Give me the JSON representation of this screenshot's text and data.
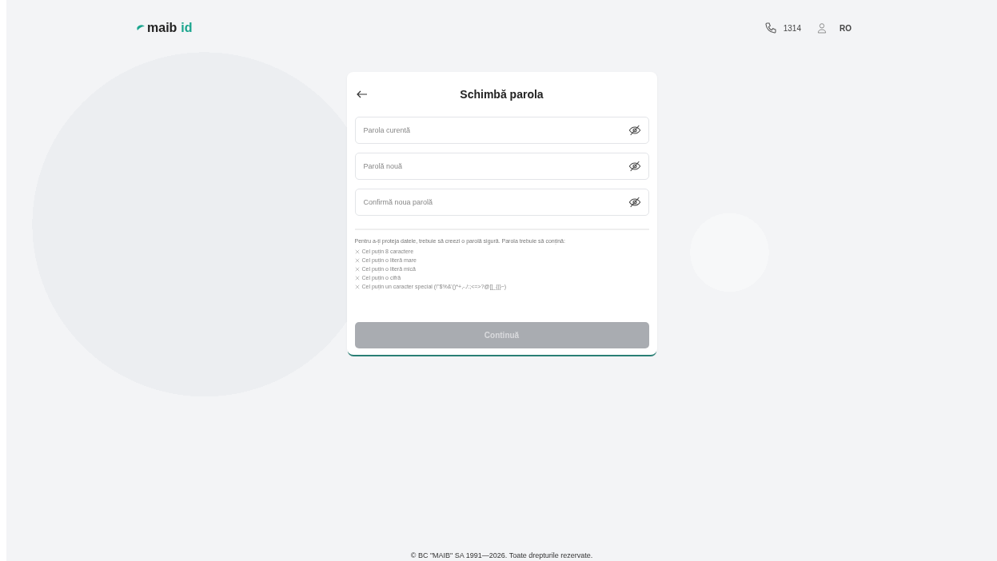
{
  "header": {
    "logo": {
      "mark": "maib",
      "suffix": "id"
    },
    "phone": "1314",
    "language": "RO"
  },
  "card": {
    "title": "Schimbă parola",
    "fields": [
      {
        "placeholder": "Parola curentă"
      },
      {
        "placeholder": "Parolă nouă"
      },
      {
        "placeholder": "Confirmă noua parolă"
      }
    ],
    "hint": "Pentru a-ți proteja datele, trebuie să creezi o parolă sigură. Parola trebuie să conțină:",
    "requirements": [
      {
        "text": "Cel puțin 8 caractere",
        "met": false
      },
      {
        "text": "Cel puțin o literă mare",
        "met": false
      },
      {
        "text": "Cel puțin o literă mică",
        "met": false
      },
      {
        "text": "Cel puțin o cifră",
        "met": false
      },
      {
        "text": "Cel puțin un caracter special (!\"$%&'()*+,-./:;<=>?@[]_{|}~)",
        "met": false
      }
    ],
    "button": {
      "label": "Continuă",
      "disabled": true
    }
  },
  "footer": "© BC \"MAIB\" SA 1991—2026. Toate drepturile rezervate."
}
